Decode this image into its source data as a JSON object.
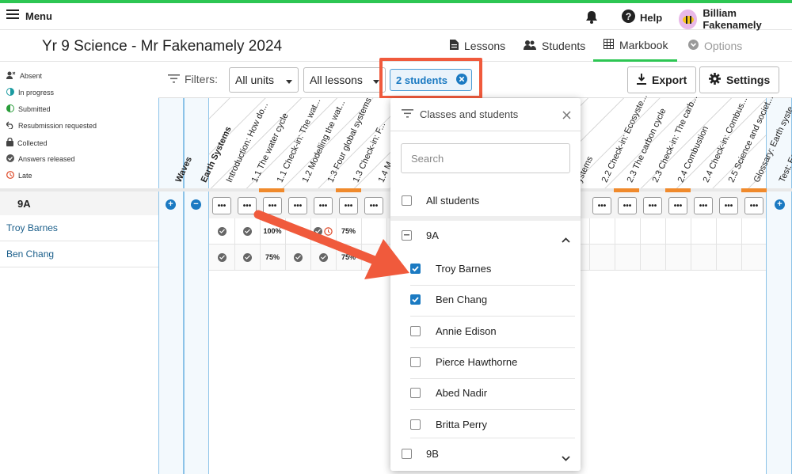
{
  "topbar": {
    "menu_label": "Menu",
    "help_label": "Help",
    "user_name": "Billiam Fakenamely"
  },
  "page_title": "Yr 9 Science - Mr Fakenamely 2024",
  "nav_tabs": [
    {
      "label": "Lessons"
    },
    {
      "label": "Students"
    },
    {
      "label": "Markbook"
    },
    {
      "label": "Options"
    }
  ],
  "legend": [
    {
      "label": "Absent"
    },
    {
      "label": "In progress"
    },
    {
      "label": "Submitted"
    },
    {
      "label": "Resubmission requested"
    },
    {
      "label": "Collected"
    },
    {
      "label": "Answers released"
    },
    {
      "label": "Late"
    }
  ],
  "filters": {
    "label": "Filters:",
    "units": "All units",
    "lessons": "All lessons",
    "students": "2 students"
  },
  "toolbar": {
    "export": "Export",
    "settings": "Settings"
  },
  "units": [
    "Waves",
    "Earth Systems"
  ],
  "columns": [
    "Introduction: How do...",
    "1.1 The water cycle",
    "1.1 Check-in: The wat...",
    "1.2 Modelling the wat...",
    "1.3 Four global systems",
    "1.3 Check-in: F...",
    "1.4 M...",
    "ystems",
    "2.2 Check-in: Ecosyste...",
    "2.3 The carbon cycle",
    "2.3 Check-in: The carb...",
    "2.4 Combustion",
    "2.4 Check-in: Combus...",
    "2.5 Science and societ...",
    "Glossary: Earth syste...",
    "Test: Earth"
  ],
  "class_section": "9A",
  "students": [
    "Troy Barnes",
    "Ben Chang"
  ],
  "row_values": {
    "troy": [
      "100%",
      "75%"
    ],
    "ben": [
      "75%",
      "75%"
    ]
  },
  "dropdown": {
    "title": "Classes and students",
    "search_placeholder": "Search",
    "all_label": "All students",
    "class_a": "9A",
    "students": [
      {
        "name": "Troy Barnes",
        "checked": true
      },
      {
        "name": "Ben Chang",
        "checked": true
      },
      {
        "name": "Annie Edison",
        "checked": false
      },
      {
        "name": "Pierce Hawthorne",
        "checked": false
      },
      {
        "name": "Abed Nadir",
        "checked": false
      },
      {
        "name": "Britta Perry",
        "checked": false
      }
    ],
    "class_b": "9B"
  },
  "colors": {
    "accent": "#1b7ac2",
    "brand_green": "#2dc653",
    "highlight": "#f05a3c",
    "progress": "#f08a2c"
  }
}
